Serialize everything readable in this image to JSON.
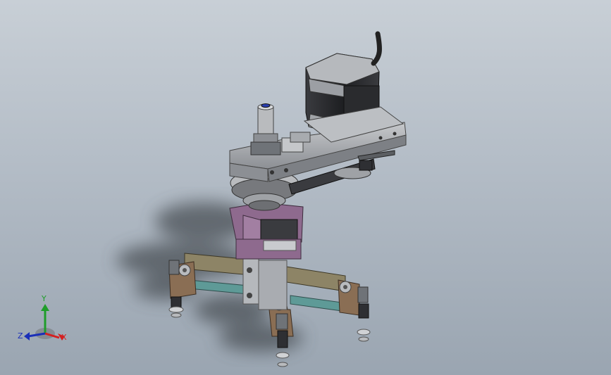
{
  "triad": {
    "x_label": "X",
    "y_label": "Y",
    "z_label": "Z",
    "x_color": "#d42020",
    "y_color": "#1f9d2a",
    "z_color": "#1a2fb8"
  },
  "colors": {
    "bg_top": "#c8cfd6",
    "bg_bottom": "#9aa5b1",
    "steel": "#9c9fa4",
    "dark": "#2e2f33",
    "purple": "#8e6a8e",
    "olive": "#8d8466",
    "teal": "#5e9a97",
    "brown": "#8a6e54"
  }
}
